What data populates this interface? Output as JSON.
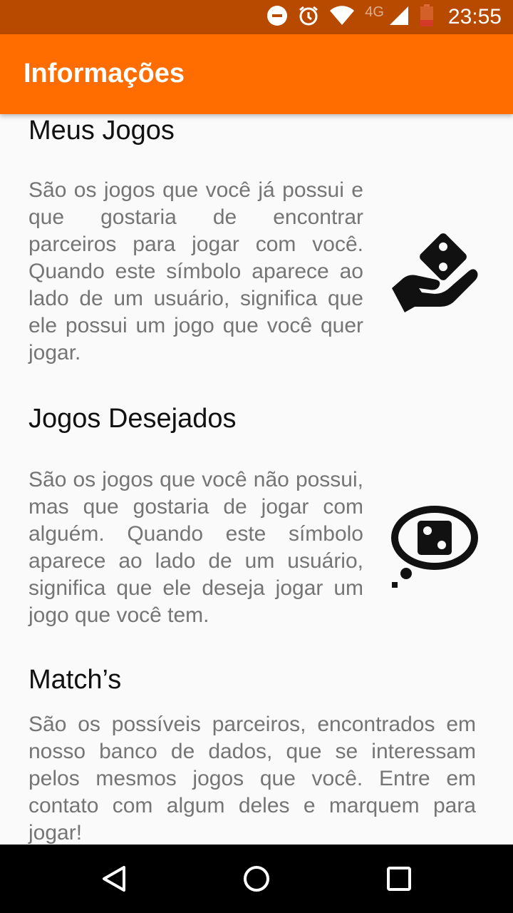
{
  "status_bar": {
    "time": "23:55",
    "network": "4G",
    "icons": [
      "do-not-disturb-icon",
      "alarm-icon",
      "wifi-icon",
      "signal-icon",
      "battery-low-icon"
    ]
  },
  "app_bar": {
    "title": "Informações"
  },
  "sections": [
    {
      "title": "Meus Jogos",
      "text": "São os jogos que você já possui e que gostaria de encontrar parceiros para jogar com você. Quando este símbolo aparece ao lado de um usuário, significa que ele possui um jogo que você quer jogar.",
      "icon": "hand-with-dice-icon"
    },
    {
      "title": "Jogos Desejados",
      "text": "São os jogos que você não possui, mas que gostaria de jogar com alguém. Quando este símbolo aparece ao lado de um usuário, significa que ele deseja jogar um jogo que você tem.",
      "icon": "thought-bubble-dice-icon"
    },
    {
      "title": "Match’s",
      "text": "São os possíveis parceiros, encontrados em nosso banco de dados, que se interessam pelos mesmos jogos que você. Entre em contato com algum deles e marquem para jogar!"
    }
  ],
  "nav_bar": {
    "buttons": [
      "back-icon",
      "home-icon",
      "recents-icon"
    ]
  },
  "colors": {
    "status_bar": "#b84a00",
    "app_bar": "#ff6d00",
    "background": "#fafafa",
    "body_text": "#757575"
  }
}
